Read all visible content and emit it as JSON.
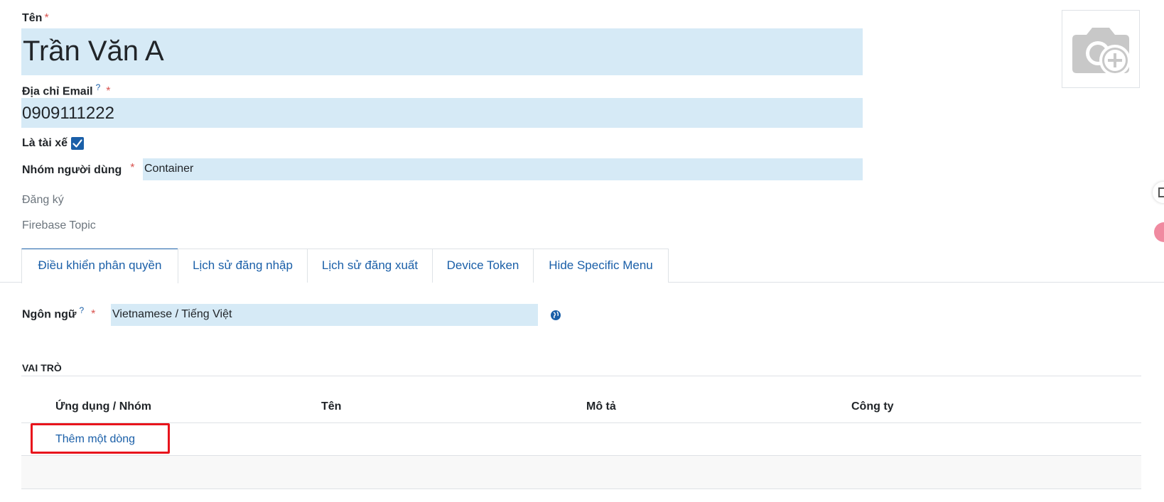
{
  "form": {
    "name_label": "Tên",
    "required_mark": "*",
    "help_mark": "?",
    "name_value": "Trần Văn A",
    "email_label": "Địa chỉ Email",
    "email_value": "0909111222",
    "driver_label": "Là tài xế",
    "driver_checked": true,
    "group_label": "Nhóm người dùng",
    "group_value": "Container",
    "register_label": "Đăng ký",
    "firebase_label": "Firebase Topic"
  },
  "tabs": [
    {
      "label": "Điều khiển phân quyền",
      "active": true
    },
    {
      "label": "Lịch sử đăng nhập",
      "active": false
    },
    {
      "label": "Lịch sử đăng xuất",
      "active": false
    },
    {
      "label": "Device Token",
      "active": false
    },
    {
      "label": "Hide Specific Menu",
      "active": false
    }
  ],
  "language": {
    "label": "Ngôn ngữ",
    "value": "Vietnamese / Tiếng Việt"
  },
  "roles": {
    "section_title": "VAI TRÒ",
    "columns": [
      "Ứng dụng / Nhóm",
      "Tên",
      "Mô tả",
      "Công ty"
    ],
    "add_line": "Thêm một dòng"
  },
  "colors": {
    "accent": "#1a5fa8",
    "field_bg": "#d6eaf6",
    "highlight_box": "#e8141c"
  }
}
